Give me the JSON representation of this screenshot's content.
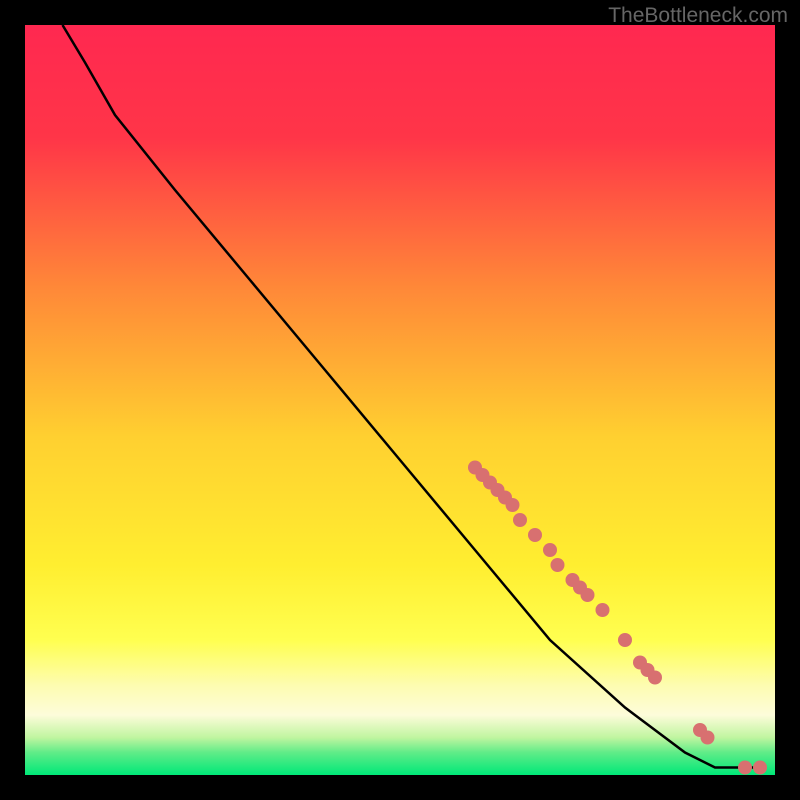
{
  "watermark": "TheBottleneck.com",
  "chart_data": {
    "type": "line",
    "title": "",
    "xlabel": "",
    "ylabel": "",
    "xlim": [
      0,
      100
    ],
    "ylim": [
      0,
      100
    ],
    "gradient_colors": {
      "top": "#ff2850",
      "mid_upper": "#ff6040",
      "mid": "#ffd030",
      "mid_lower": "#ffff50",
      "lower": "#fdfcda",
      "bottom": "#00e878"
    },
    "curve": [
      {
        "x": 5,
        "y": 100
      },
      {
        "x": 8,
        "y": 95
      },
      {
        "x": 12,
        "y": 88
      },
      {
        "x": 20,
        "y": 78
      },
      {
        "x": 30,
        "y": 66
      },
      {
        "x": 40,
        "y": 54
      },
      {
        "x": 50,
        "y": 42
      },
      {
        "x": 60,
        "y": 30
      },
      {
        "x": 70,
        "y": 18
      },
      {
        "x": 80,
        "y": 9
      },
      {
        "x": 88,
        "y": 3
      },
      {
        "x": 92,
        "y": 1
      },
      {
        "x": 95,
        "y": 1
      },
      {
        "x": 98,
        "y": 1
      }
    ],
    "data_points": [
      {
        "x": 60,
        "y": 41
      },
      {
        "x": 61,
        "y": 40
      },
      {
        "x": 62,
        "y": 39
      },
      {
        "x": 63,
        "y": 38
      },
      {
        "x": 64,
        "y": 37
      },
      {
        "x": 65,
        "y": 36
      },
      {
        "x": 66,
        "y": 34
      },
      {
        "x": 68,
        "y": 32
      },
      {
        "x": 70,
        "y": 30
      },
      {
        "x": 71,
        "y": 28
      },
      {
        "x": 73,
        "y": 26
      },
      {
        "x": 74,
        "y": 25
      },
      {
        "x": 75,
        "y": 24
      },
      {
        "x": 77,
        "y": 22
      },
      {
        "x": 80,
        "y": 18
      },
      {
        "x": 82,
        "y": 15
      },
      {
        "x": 83,
        "y": 14
      },
      {
        "x": 84,
        "y": 13
      },
      {
        "x": 90,
        "y": 6
      },
      {
        "x": 91,
        "y": 5
      },
      {
        "x": 96,
        "y": 1
      },
      {
        "x": 98,
        "y": 1
      }
    ],
    "point_color": "#d87070",
    "curve_color": "#000000"
  }
}
